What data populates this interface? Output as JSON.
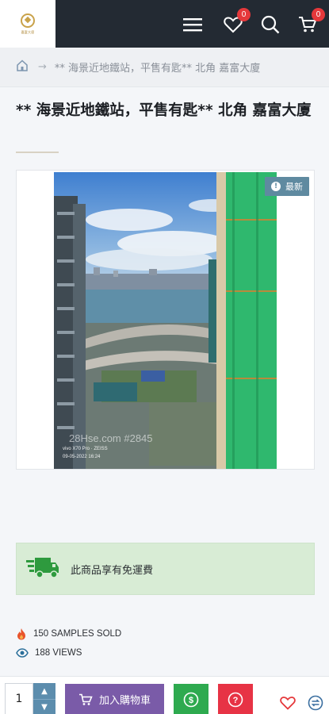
{
  "header": {
    "logo_text": "嘉富大廈",
    "wishlist_count": "0",
    "cart_count": "0"
  },
  "breadcrumb": {
    "current": "** 海景近地鐵站，平售有匙** 北角 嘉富大廈"
  },
  "product": {
    "title": "** 海景近地鐵站，平售有匙** 北角 嘉富大廈",
    "badge": "最新",
    "watermark": "28Hse.com #2845",
    "photo_caption_1": "vivo X70 Pro · ZEISS",
    "photo_caption_2": "09-05-2022 16:24"
  },
  "shipping": {
    "text": "此商品享有免運費"
  },
  "stats": {
    "sold": "150 SAMPLES SOLD",
    "views": "188 VIEWS"
  },
  "bottom_bar": {
    "quantity": "1",
    "add_to_cart": "加入購物車"
  },
  "colors": {
    "header_bg": "#232a33",
    "badge_red": "#e5383b",
    "cart_purple": "#7a5ba8",
    "buy_green": "#2eaa4f",
    "question_red": "#e73345",
    "stepper_blue": "#5c8dad",
    "shipping_bg": "#d8ecd5"
  }
}
